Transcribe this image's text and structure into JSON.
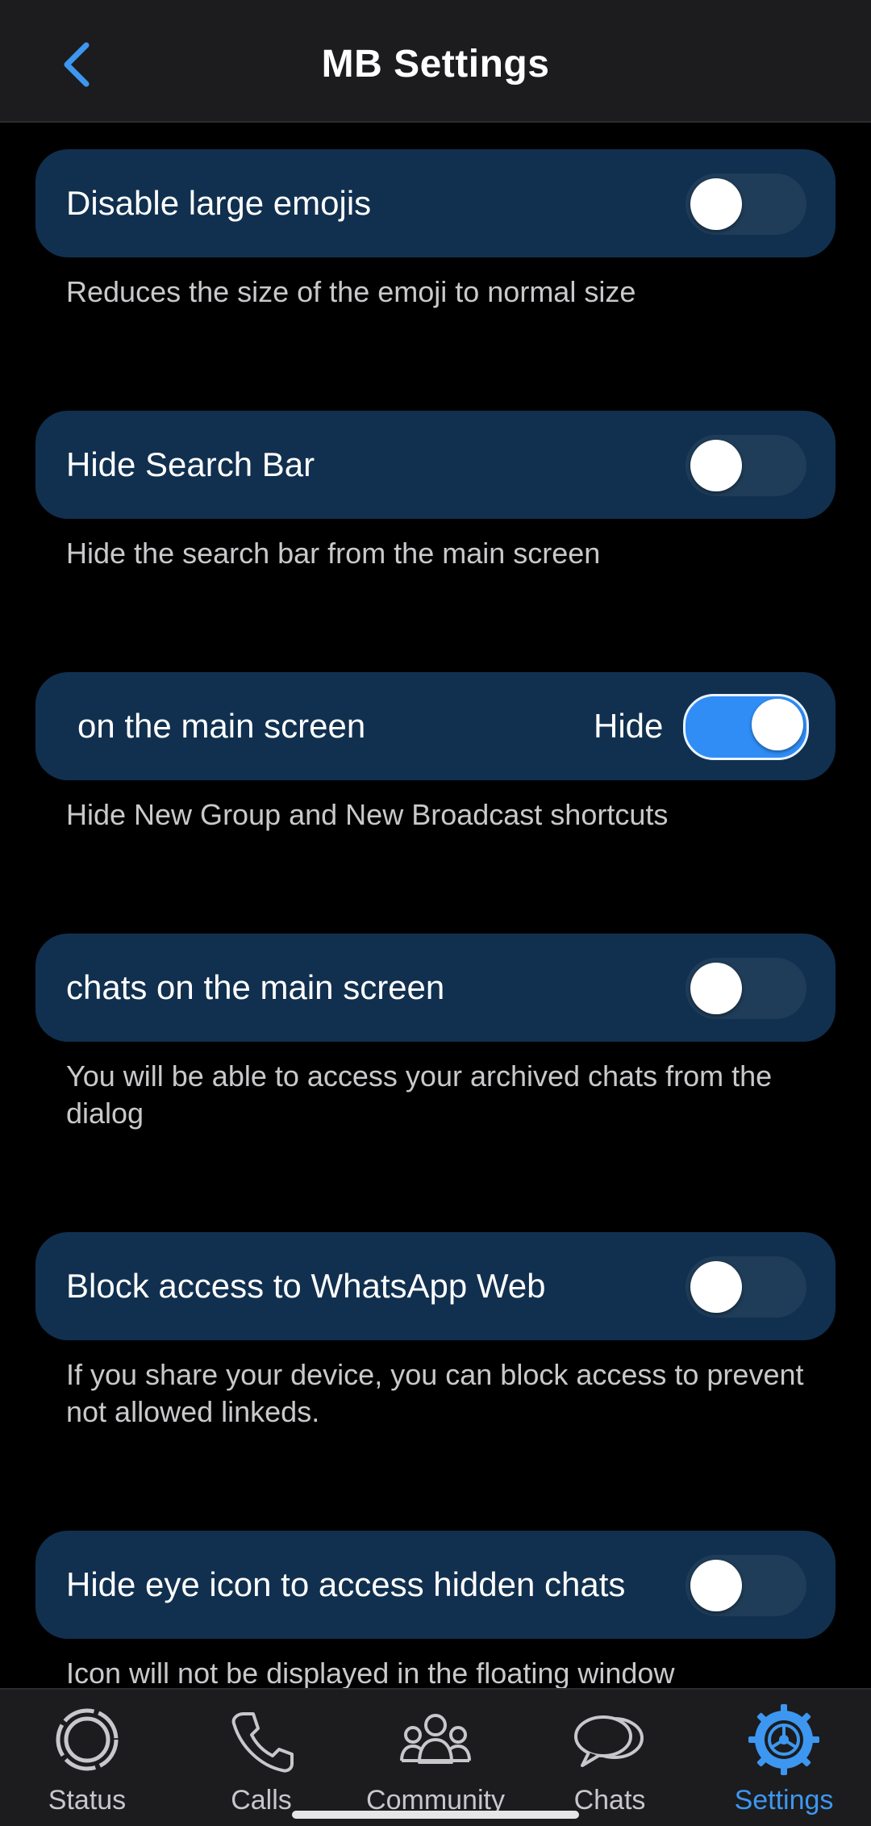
{
  "header": {
    "title": "MB Settings",
    "back_icon": "chevron-left-icon"
  },
  "colors": {
    "accent": "#2f8df5",
    "card": "#11304f",
    "background": "#000000"
  },
  "settings": [
    {
      "label": "Disable large emojis",
      "description": "Reduces the size of the emoji to normal size",
      "enabled": false
    },
    {
      "label": "Hide Search Bar",
      "description": "Hide the search bar from the main screen",
      "enabled": false
    },
    {
      "label_visible_part_1": "on the main screen",
      "label_visible_part_2": "Hide",
      "description": "Hide New Group and New Broadcast shortcuts",
      "enabled": true
    },
    {
      "label_visible": "chats on the main screen",
      "description": "You will be able to access your archived chats from the dialog",
      "enabled": false
    },
    {
      "label": "Block access to WhatsApp Web",
      "description": "If you share your device, you can block access to prevent not allowed linkeds.",
      "enabled": false
    },
    {
      "label": "Hide eye icon to access hidden chats",
      "description": "Icon will not be displayed in the floating window",
      "enabled": false
    }
  ],
  "bottom_nav": {
    "items": [
      {
        "label": "Status",
        "icon": "status-icon"
      },
      {
        "label": "Calls",
        "icon": "phone-icon"
      },
      {
        "label": "Community",
        "icon": "community-icon"
      },
      {
        "label": "Chats",
        "icon": "chat-bubbles-icon"
      },
      {
        "label": "Settings",
        "icon": "settings-gear-icon",
        "active": true
      }
    ]
  }
}
